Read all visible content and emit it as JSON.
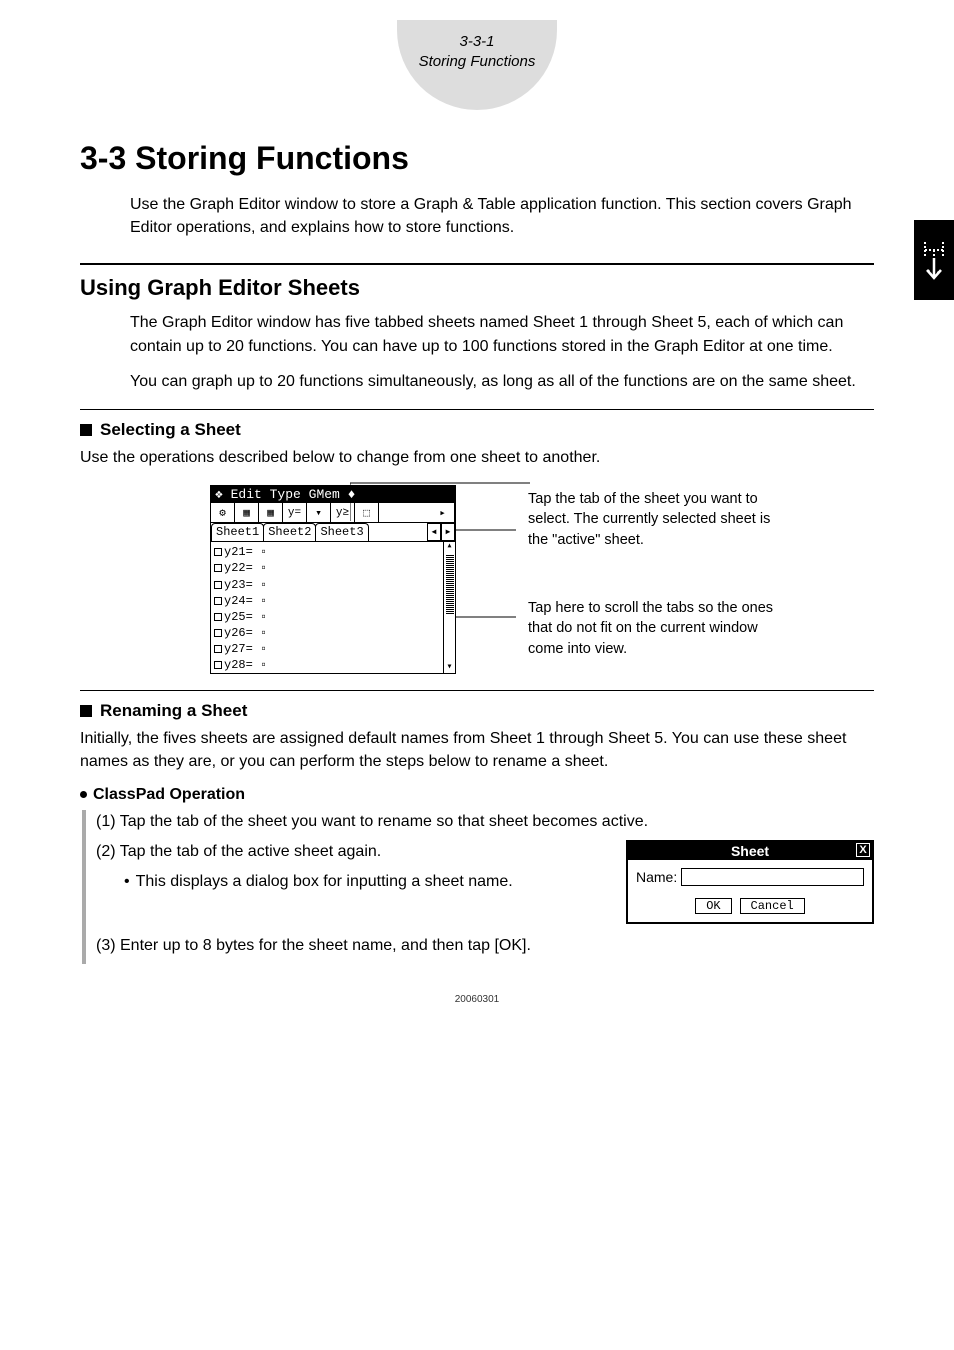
{
  "header": {
    "code": "3-3-1",
    "title": "Storing Functions"
  },
  "chapter": {
    "heading": "3-3  Storing Functions"
  },
  "intro": "Use the Graph Editor window to store a Graph & Table application function. This section covers Graph Editor operations, and explains how to store functions.",
  "section": {
    "heading": "Using Graph Editor Sheets",
    "body1": "The Graph Editor window has five tabbed sheets named Sheet 1 through Sheet 5, each of which can contain up to 20 functions. You can have up to 100 functions stored in the Graph Editor at one time.",
    "body2": "You can graph up to 20 functions simultaneously, as long as all of the functions are on the same sheet."
  },
  "sub1": {
    "heading": "Selecting a Sheet",
    "desc": "Use the operations described below to change from one sheet to another.",
    "callout1": "Tap the tab of the sheet you want to select. The currently selected sheet is the \"active\" sheet.",
    "callout2": "Tap here to scroll the tabs so the ones that do not fit on the current window come into view."
  },
  "calc": {
    "menubar": "❖  Edit  Type  GMem  ♦",
    "toolbar": [
      "⚙",
      "▦",
      "▦",
      "y=",
      "▾",
      "y≥",
      "⬚",
      "▸"
    ],
    "tabs": [
      "Sheet1",
      "Sheet2",
      "Sheet3"
    ],
    "rows": [
      "y21= ▫",
      "y22= ▫",
      "y23= ▫",
      "y24= ▫",
      "y25= ▫",
      "y26= ▫",
      "y27= ▫",
      "y28= ▫"
    ]
  },
  "sub2": {
    "heading": "Renaming a Sheet",
    "desc": "Initially, the fives sheets are assigned default names from Sheet 1 through Sheet 5. You can use these sheet names as they are, or you can perform the steps below to rename a sheet."
  },
  "op": {
    "heading": "ClassPad Operation",
    "step1": "(1) Tap the tab of the sheet you want to rename so that sheet becomes active.",
    "step2": "(2) Tap the tab of the active sheet again.",
    "step2_sub": "This displays a dialog box for inputting a sheet name.",
    "step3": "(3) Enter up to 8 bytes for the sheet name, and then tap [OK]."
  },
  "dialog": {
    "title": "Sheet",
    "name_label": "Name:",
    "name_value": "",
    "ok": "OK",
    "cancel": "Cancel"
  },
  "footer": "20060301"
}
